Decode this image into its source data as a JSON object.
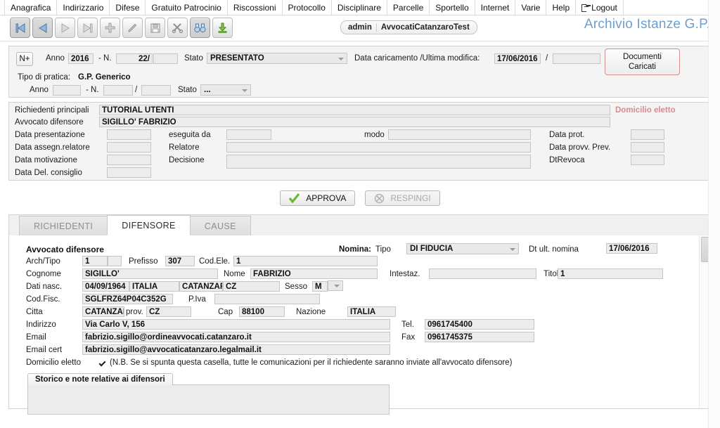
{
  "menu": {
    "items": [
      {
        "label": "Anagrafica"
      },
      {
        "label": "Indirizzario"
      },
      {
        "label": "Difese"
      },
      {
        "label": "Gratuito Patrocinio"
      },
      {
        "label": "Riscossioni"
      },
      {
        "label": "Protocollo"
      },
      {
        "label": "Disciplinare"
      },
      {
        "label": "Parcelle"
      },
      {
        "label": "Sportello"
      },
      {
        "label": "Internet"
      },
      {
        "label": "Varie"
      },
      {
        "label": "Help"
      },
      {
        "label": "Logout"
      }
    ]
  },
  "toolbar": {
    "icons": [
      {
        "name": "first-record-icon",
        "state": "enabled"
      },
      {
        "name": "previous-record-icon",
        "state": "enabled"
      },
      {
        "name": "next-record-icon",
        "state": "disabled"
      },
      {
        "name": "last-record-icon",
        "state": "disabled"
      },
      {
        "name": "add-record-icon",
        "state": "enabled"
      },
      {
        "name": "edit-record-icon",
        "state": "enabled"
      },
      {
        "name": "save-record-icon",
        "state": "enabled"
      },
      {
        "name": "delete-record-icon",
        "state": "enabled"
      },
      {
        "name": "search-binoculars-icon",
        "state": "enabled"
      },
      {
        "name": "export-download-icon",
        "state": "enabled"
      }
    ],
    "user_role": "admin",
    "user_tenant": "AvvocatiCatanzaroTest",
    "app_title": "Archivio Istanze G.P.",
    "app_title_color": "#6d9fd0"
  },
  "header": {
    "np_button": "N+",
    "anno_label": "Anno",
    "anno_value": "2016",
    "n_label": "- N.",
    "n_value": "22/",
    "n_suffix_value": "",
    "stato_label": "Stato",
    "stato_value": "PRESENTATO",
    "data_caricamento_label": "Data caricamento /Ultima modifica:",
    "data_caricamento_value": "17/06/2016",
    "data_sep": "/",
    "data_modifica_value": "",
    "documenti_line1": "Documenti",
    "documenti_line2": "Caricati",
    "documenti_border_color": "#d08e8e",
    "tipo_pratica_label": "Tipo di pratica:",
    "tipo_pratica_value": "G.P. Generico",
    "sub_anno_label": "Anno",
    "sub_anno_value": "",
    "sub_n_label": "- N.",
    "sub_n_value": "",
    "sub_slash": "/",
    "sub_n2_value": "",
    "sub_stato_label": "Stato",
    "sub_stato_value": "..."
  },
  "detail": {
    "richiedenti_label": "Richiedenti principali",
    "richiedenti_value": "TUTORIAL UTENTI",
    "avvocato_label": "Avvocato difensore",
    "avvocato_value": "SIGILLO' FABRIZIO",
    "domicilio_eletto_label": "Domicilio eletto",
    "domicilio_eletto_color": "#d98b8b",
    "data_presentazione_label": "Data presentazione",
    "data_presentazione_value": "",
    "eseguita_da_label": "eseguita da",
    "eseguita_da_value": "",
    "modo_label": "modo",
    "modo_value": "",
    "data_prot_label": "Data prot.",
    "data_prot_value": "",
    "data_assegn_label": "Data assegn.relatore",
    "data_assegn_value": "",
    "relatore_label": "Relatore",
    "relatore_value": "",
    "data_provv_label": "Data provv. Prev.",
    "data_provv_value": "",
    "data_motivazione_label": "Data motivazione",
    "data_motivazione_value": "",
    "decisione_label": "Decisione",
    "decisione_value": "",
    "dtrevoca_label": "DtRevoca",
    "dtrevoca_value": "",
    "data_del_consiglio_label": "Data Del. consiglio",
    "data_del_consiglio_value": ""
  },
  "actions": {
    "approva_label": "APPROVA",
    "approva_icon": "green-check-icon",
    "respingi_label": "RESPINGI",
    "respingi_icon": "reject-circle-icon",
    "respingi_disabled": true
  },
  "tabs": [
    {
      "label": "RICHIEDENTI",
      "active": false
    },
    {
      "label": "DIFENSORE",
      "active": true
    },
    {
      "label": "CAUSE",
      "active": false
    }
  ],
  "difensore": {
    "section_title": "Avvocato difensore",
    "nomina_label": "Nomina:",
    "tipo_label": "Tipo",
    "tipo_value": "DI FIDUCIA",
    "dt_ult_nomina_label": "Dt ult. nomina",
    "dt_ult_nomina_value": "17/06/2016",
    "arch_tipo_label": "Arch/Tipo",
    "arch_tipo_value": "1",
    "arch_tipo_value2": "",
    "prefisso_label": "Prefisso",
    "prefisso_value": "307",
    "cod_ele_label": "Cod.Ele.",
    "cod_ele_value": "1",
    "cognome_label": "Cognome",
    "cognome_value": "SIGILLO'",
    "nome_label": "Nome",
    "nome_value": "FABRIZIO",
    "intestaz_label": "Intestaz.",
    "intestaz_value": "",
    "titolo_label": "Titolo",
    "titolo_value": "1",
    "dati_nasc_label": "Dati nasc.",
    "data_nascita_value": "04/09/1964",
    "nazione_nascita_value": "ITALIA",
    "citta_nascita_value": "CATANZARO",
    "prov_nascita_value": "CZ",
    "sesso_label": "Sesso",
    "sesso_value": "M",
    "cod_fisc_label": "Cod.Fisc.",
    "cod_fisc_value": "SGLFRZ64P04C352G",
    "piva_label": "P.Iva",
    "piva_value": "",
    "citta_label": "Citta",
    "citta_value": "CATANZARO",
    "prov_label": "prov.",
    "prov_value": "CZ",
    "cap_label": "Cap",
    "cap_value": "88100",
    "nazione_label": "Nazione",
    "nazione_value": "ITALIA",
    "indirizzo_label": "Indirizzo",
    "indirizzo_value": "Via Carlo V, 156",
    "tel_label": "Tel.",
    "tel_value": "0961745400",
    "email_label": "Email",
    "email_value": "fabrizio.sigillo@ordineavvocati.catanzaro.it",
    "fax_label": "Fax",
    "fax_value": "0961745375",
    "email_cert_label": "Email cert",
    "email_cert_value": "fabrizio.sigillo@avvocaticatanzaro.legalmail.it",
    "domicilio_eletto_label": "Domicilio eletto",
    "domicilio_eletto_checked": true,
    "domicilio_eletto_note": "(N.B. Se si spunta questa casella, tutte le comunicazioni per il richiedente saranno inviate all'avvocato difensore)",
    "storico_tab_label": "Storico e note relative ai difensori",
    "storico_value": ""
  }
}
